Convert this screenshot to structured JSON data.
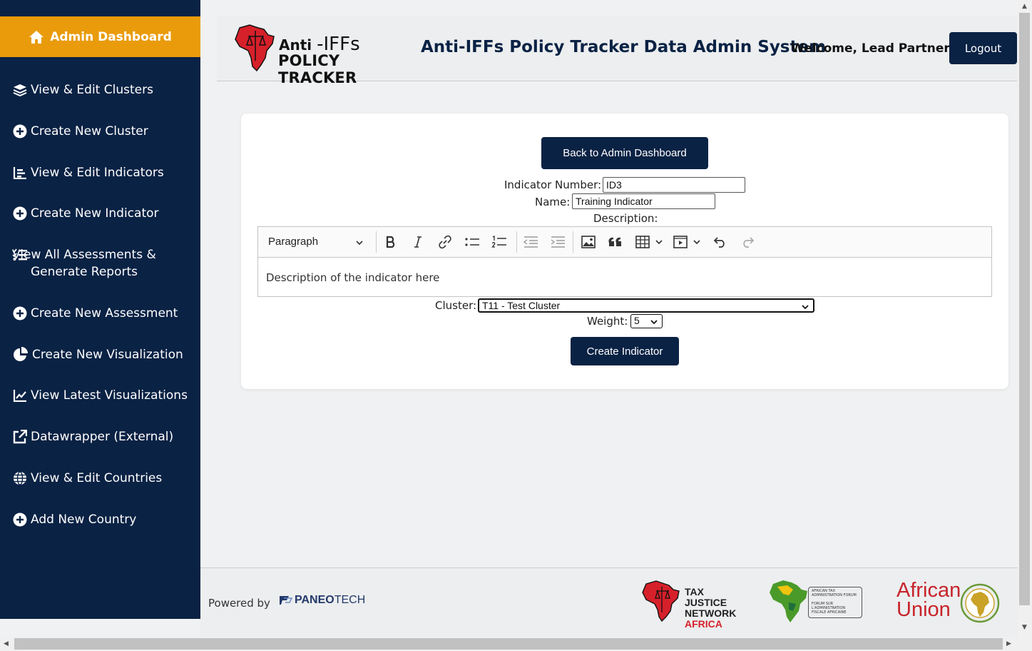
{
  "sidebar": {
    "dashboard_label": "Admin Dashboard",
    "items": [
      {
        "label": "View & Edit Clusters",
        "icon": "layers-icon"
      },
      {
        "label": "Create New Cluster",
        "icon": "plus-circle-icon"
      },
      {
        "label": "View & Edit Indicators",
        "icon": "list-chart-icon"
      },
      {
        "label": "Create New Indicator",
        "icon": "plus-circle-icon"
      },
      {
        "label": "View All Assessments &\nGenerate Reports",
        "icon": "checklist-icon"
      },
      {
        "label": "Create New Assessment",
        "icon": "plus-circle-icon"
      },
      {
        "label": "Create New Visualization",
        "icon": "pie-chart-icon"
      },
      {
        "label": "View Latest Visualizations",
        "icon": "line-chart-icon"
      },
      {
        "label": "Datawrapper (External)",
        "icon": "external-link-icon"
      },
      {
        "label": "View & Edit Countries",
        "icon": "globe-icon"
      },
      {
        "label": "Add New Country",
        "icon": "plus-circle-icon"
      }
    ]
  },
  "header": {
    "logo_line1_a": "Anti",
    "logo_line1_b": "-IFFs",
    "logo_line2": "POLICY TRACKER",
    "title": "Anti-IFFs Policy Tracker Data Admin System",
    "welcome": "Welcome, Lead Partner!",
    "logout_label": "Logout"
  },
  "form": {
    "back_label": "Back to Admin Dashboard",
    "indicator_number_label": "Indicator Number:",
    "indicator_number_value": "ID3",
    "name_label": "Name:",
    "name_value": "Training Indicator",
    "description_label": "Description:",
    "editor_block_style": "Paragraph",
    "editor_content": "Description of the indicator here",
    "cluster_label": "Cluster:",
    "cluster_value": "T11 - Test Cluster",
    "weight_label": "Weight:",
    "weight_value": "5",
    "submit_label": "Create Indicator"
  },
  "footer": {
    "powered_by": "Powered by",
    "paneo_a": "PANEO",
    "paneo_b": "TECH",
    "tjn_l1": "TAX JUSTICE",
    "tjn_l2": "NETWORK",
    "tjn_l3": "AFRICA",
    "ataf_l1": "AFRICAN TAX ADMINISTRATION FORUM",
    "ataf_l2": "FORUM SUR L'ADMINISTRATION FISCALE AFRICAINE",
    "au_l1": "African",
    "au_l2": "Union"
  },
  "colors": {
    "navy": "#0a2244",
    "accent": "#e99b0b",
    "brand_red": "#d6202a"
  }
}
